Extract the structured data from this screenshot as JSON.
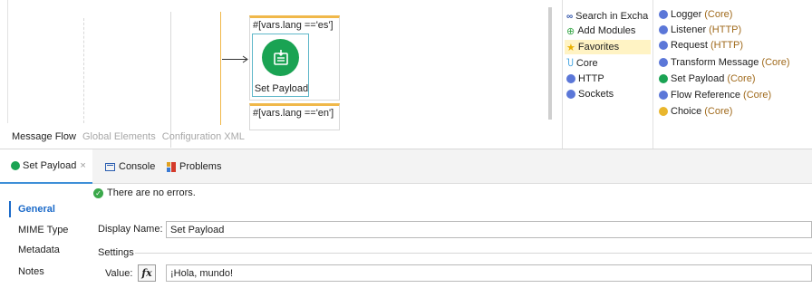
{
  "flow": {
    "when_es": "#[vars.lang =='es']",
    "when_en": "#[vars.lang =='en']",
    "component_label": "Set Payload"
  },
  "flow_tabs": [
    "Message Flow",
    "Global Elements",
    "Configuration XML"
  ],
  "palette": {
    "left": [
      {
        "label": "Search in Excha",
        "icon": "search-exchange-icon"
      },
      {
        "label": "Add Modules",
        "icon": "add-modules-icon"
      },
      {
        "label": "Favorites",
        "icon": "favorites-star-icon"
      },
      {
        "label": "Core",
        "icon": "core-icon"
      },
      {
        "label": "HTTP",
        "icon": "http-icon"
      },
      {
        "label": "Sockets",
        "icon": "sockets-icon"
      }
    ],
    "right": [
      {
        "name": "Logger",
        "module": "(Core)",
        "icon": "logger-icon"
      },
      {
        "name": "Listener",
        "module": "(HTTP)",
        "icon": "listener-icon"
      },
      {
        "name": "Request",
        "module": "(HTTP)",
        "icon": "request-icon"
      },
      {
        "name": "Transform Message",
        "module": "(Core)",
        "icon": "transform-message-icon"
      },
      {
        "name": "Set Payload",
        "module": "(Core)",
        "icon": "set-payload-icon"
      },
      {
        "name": "Flow Reference",
        "module": "(Core)",
        "icon": "flow-reference-icon"
      },
      {
        "name": "Choice",
        "module": "(Core)",
        "icon": "choice-icon"
      }
    ]
  },
  "bottom_tabs": {
    "set_payload": "Set Payload",
    "close": "×",
    "console": "Console",
    "problems": "Problems"
  },
  "side_nav": [
    "General",
    "MIME Type",
    "Metadata",
    "Notes"
  ],
  "general": {
    "status": "There are no errors.",
    "display_name_label": "Display Name:",
    "display_name_value": "Set Payload",
    "settings_label": "Settings",
    "value_label": "Value:",
    "fx_label": "fx",
    "value": "¡Hola, mundo!"
  },
  "colors": {
    "accent_blue": "#1b6ac9",
    "flow_orange": "#f0b84a",
    "set_payload_green": "#1aa353",
    "module_text": "#a06a1c"
  }
}
